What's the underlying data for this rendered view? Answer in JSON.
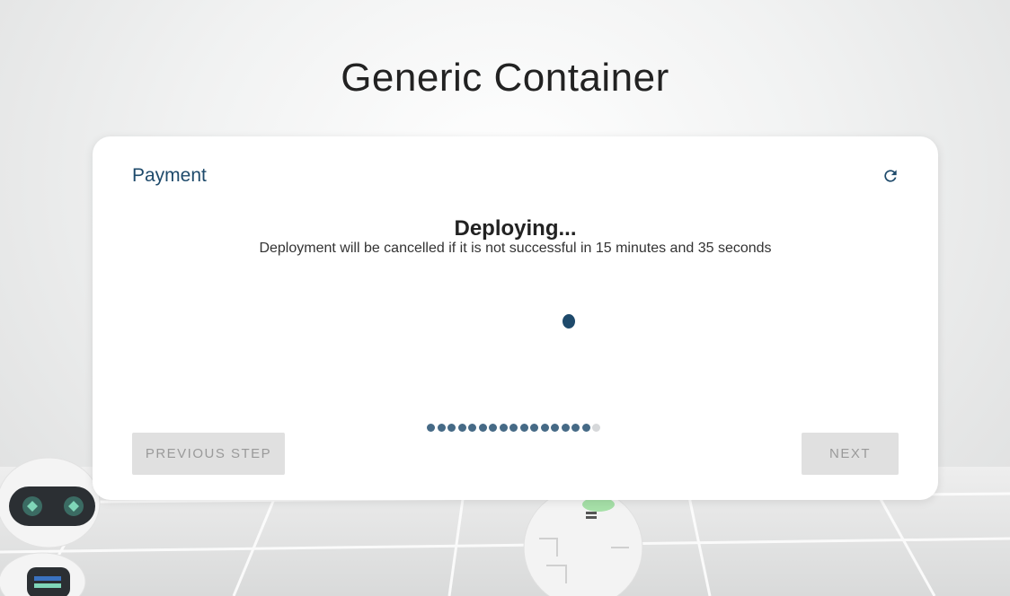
{
  "page": {
    "title": "Generic Container"
  },
  "wizard": {
    "step_title": "Payment",
    "status_heading": "Deploying...",
    "status_message": "Deployment will be cancelled if it is not successful in 15 minutes and 35 seconds",
    "progress": {
      "completed_steps": 16,
      "total_steps": 17
    },
    "prev_label": "PREVIOUS STEP",
    "next_label": "NEXT"
  },
  "icons": {
    "refresh": "refresh-icon"
  },
  "colors": {
    "accent": "#1e4a6b",
    "dot_active": "#466a86",
    "dot_inactive": "#d6d8da",
    "button_bg": "#e0e0e0",
    "button_text": "#9a9a9a"
  }
}
